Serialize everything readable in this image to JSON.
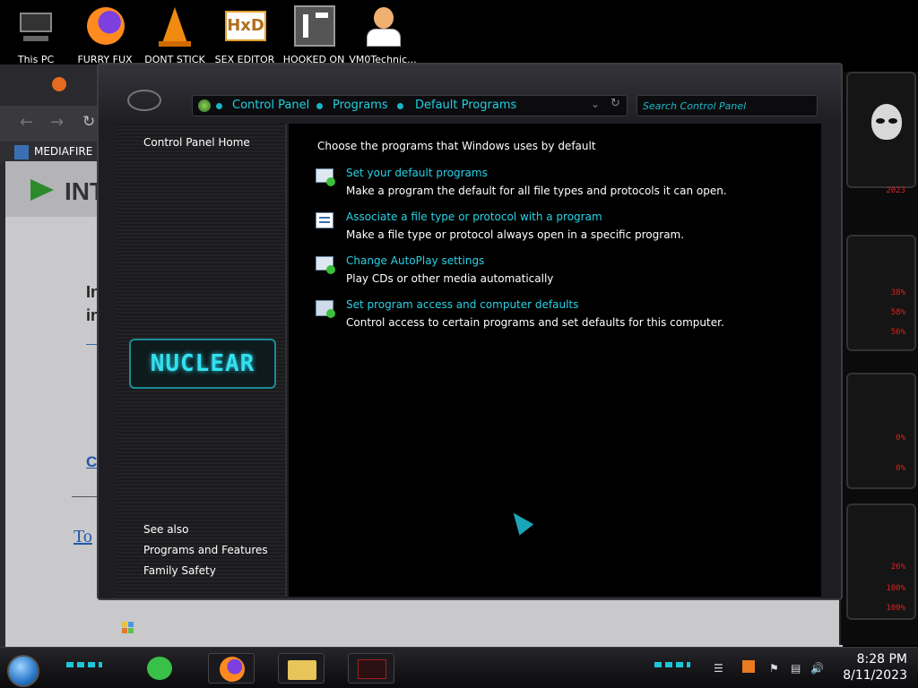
{
  "desktop": {
    "icons": [
      {
        "label": "This PC"
      },
      {
        "label": "FURRY FUX"
      },
      {
        "label": "DONT STICK"
      },
      {
        "label": "SEX EDITOR"
      },
      {
        "label": "HOOKED ON"
      },
      {
        "label": "VM0Technic..."
      }
    ]
  },
  "browser": {
    "bookmark_label": "MEDIAFIRE RC",
    "banner_text": "INT",
    "ghost_lines": [
      "In",
      "in"
    ],
    "link_fragments": [
      "Co",
      "To"
    ]
  },
  "window": {
    "breadcrumb": [
      {
        "label": "Control Panel"
      },
      {
        "label": "Programs"
      },
      {
        "label": "Default Programs"
      }
    ],
    "search_placeholder": "Search Control Panel",
    "sidebar": {
      "home": "Control Panel Home",
      "banner": "NUCLEAR",
      "see_also": "See also",
      "links": [
        {
          "label": "Programs and Features"
        },
        {
          "label": "Family Safety"
        }
      ]
    },
    "main": {
      "heading": "Choose the programs that Windows uses by default",
      "tasks": [
        {
          "link": "Set your default programs",
          "desc": "Make a program the default for all file types and protocols it can open."
        },
        {
          "link": "Associate a file type or protocol with a program",
          "desc": "Make a file type or protocol always open in a specific program."
        },
        {
          "link": "Change AutoPlay settings",
          "desc": "Play CDs or other media automatically"
        },
        {
          "link": "Set program access and computer defaults",
          "desc": "Control access to certain programs and set defaults for this computer."
        }
      ]
    }
  },
  "gadget": {
    "year": "2023",
    "readings": [
      "38%",
      "58%",
      "56%",
      "0%",
      "0%",
      "26%",
      "100%",
      "100%"
    ]
  },
  "taskbar": {
    "time": "8:28 PM",
    "date": "8/11/2023"
  },
  "colors": {
    "accent": "#27d3e6",
    "window_bg": "#1e1e22",
    "content_bg": "#000000",
    "gadget_red": "#e02020"
  }
}
